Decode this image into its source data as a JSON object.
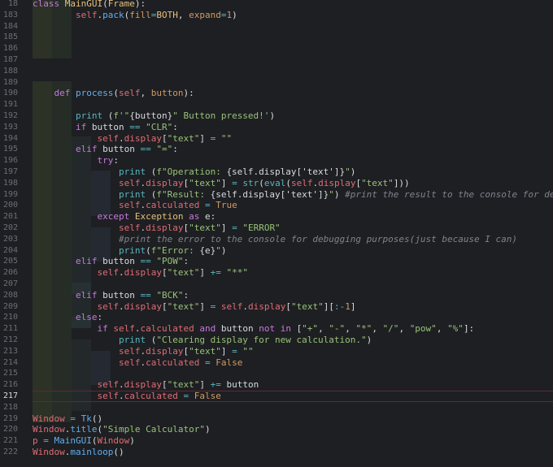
{
  "editor": {
    "current_line": "217",
    "lines": [
      {
        "n": "18",
        "t": [
          [
            "kw",
            "class "
          ],
          [
            "cls",
            "MainGUI"
          ],
          [
            "plain",
            "("
          ],
          [
            "cls",
            "Frame"
          ],
          [
            "plain",
            "):"
          ]
        ]
      },
      {
        "n": "183",
        "t": [
          [
            "plain",
            "        "
          ],
          [
            "self",
            "self"
          ],
          [
            "plain",
            "."
          ],
          [
            "fn",
            "pack"
          ],
          [
            "plain",
            "("
          ],
          [
            "param",
            "fill"
          ],
          [
            "op",
            "="
          ],
          [
            "cls",
            "BOTH"
          ],
          [
            "plain",
            ", "
          ],
          [
            "param",
            "expand"
          ],
          [
            "op",
            "="
          ],
          [
            "num",
            "1"
          ],
          [
            "plain",
            ")"
          ]
        ]
      },
      {
        "n": "184",
        "t": []
      },
      {
        "n": "185",
        "t": []
      },
      {
        "n": "186",
        "t": []
      },
      {
        "n": "187",
        "t": []
      },
      {
        "n": "188",
        "t": []
      },
      {
        "n": "189",
        "t": []
      },
      {
        "n": "190",
        "t": [
          [
            "plain",
            "    "
          ],
          [
            "kw",
            "def "
          ],
          [
            "fn",
            "process"
          ],
          [
            "plain",
            "("
          ],
          [
            "self",
            "self"
          ],
          [
            "plain",
            ", "
          ],
          [
            "param",
            "button"
          ],
          [
            "plain",
            "):"
          ]
        ]
      },
      {
        "n": "191",
        "t": []
      },
      {
        "n": "192",
        "t": [
          [
            "plain",
            "        "
          ],
          [
            "bltin",
            "print"
          ],
          [
            "plain",
            " ("
          ],
          [
            "str",
            "f'\""
          ],
          [
            "plain",
            "{button}"
          ],
          [
            "str",
            "\" Button pressed!'"
          ],
          [
            "plain",
            ")"
          ]
        ]
      },
      {
        "n": "193",
        "t": [
          [
            "plain",
            "        "
          ],
          [
            "kw",
            "if "
          ],
          [
            "plain",
            "button "
          ],
          [
            "op",
            "=="
          ],
          [
            "str",
            " \"CLR\""
          ],
          [
            "plain",
            ":"
          ]
        ]
      },
      {
        "n": "194",
        "t": [
          [
            "plain",
            "            "
          ],
          [
            "self",
            "self"
          ],
          [
            "plain",
            "."
          ],
          [
            "attr",
            "display"
          ],
          [
            "plain",
            "["
          ],
          [
            "str",
            "\"text\""
          ],
          [
            "plain",
            "] "
          ],
          [
            "op",
            "="
          ],
          [
            "str",
            " \"\""
          ]
        ]
      },
      {
        "n": "195",
        "t": [
          [
            "plain",
            "        "
          ],
          [
            "kw",
            "elif "
          ],
          [
            "plain",
            "button "
          ],
          [
            "op",
            "=="
          ],
          [
            "str",
            " \"=\""
          ],
          [
            "plain",
            ":"
          ]
        ]
      },
      {
        "n": "196",
        "t": [
          [
            "plain",
            "            "
          ],
          [
            "kw",
            "try"
          ],
          [
            "plain",
            ":"
          ]
        ]
      },
      {
        "n": "197",
        "t": [
          [
            "plain",
            "                "
          ],
          [
            "bltin",
            "print"
          ],
          [
            "plain",
            " ("
          ],
          [
            "str",
            "f\"Operation: "
          ],
          [
            "plain",
            "{self.display['text']}"
          ],
          [
            "str",
            "\""
          ],
          [
            "plain",
            ")"
          ]
        ]
      },
      {
        "n": "198",
        "t": [
          [
            "plain",
            "                "
          ],
          [
            "self",
            "self"
          ],
          [
            "plain",
            "."
          ],
          [
            "attr",
            "display"
          ],
          [
            "plain",
            "["
          ],
          [
            "str",
            "\"text\""
          ],
          [
            "plain",
            "] "
          ],
          [
            "op",
            "="
          ],
          [
            "plain",
            " "
          ],
          [
            "bltin",
            "str"
          ],
          [
            "plain",
            "("
          ],
          [
            "bltin",
            "eval"
          ],
          [
            "plain",
            "("
          ],
          [
            "self",
            "self"
          ],
          [
            "plain",
            "."
          ],
          [
            "attr",
            "display"
          ],
          [
            "plain",
            "["
          ],
          [
            "str",
            "\"text\""
          ],
          [
            "plain",
            "]))"
          ]
        ]
      },
      {
        "n": "199",
        "t": [
          [
            "plain",
            "                "
          ],
          [
            "bltin",
            "print"
          ],
          [
            "plain",
            " ("
          ],
          [
            "str",
            "f\"Result: "
          ],
          [
            "plain",
            "{self.display['text']}"
          ],
          [
            "str",
            "\""
          ],
          [
            "plain",
            ") "
          ],
          [
            "cmt",
            "#print the result to the console for debugging"
          ]
        ]
      },
      {
        "n": "200",
        "t": [
          [
            "plain",
            "                "
          ],
          [
            "self",
            "self"
          ],
          [
            "plain",
            "."
          ],
          [
            "attr",
            "calculated"
          ],
          [
            "plain",
            " "
          ],
          [
            "op",
            "="
          ],
          [
            "plain",
            " "
          ],
          [
            "num",
            "True"
          ]
        ]
      },
      {
        "n": "201",
        "t": [
          [
            "plain",
            "            "
          ],
          [
            "kw",
            "except "
          ],
          [
            "cls",
            "Exception"
          ],
          [
            "kw",
            " as "
          ],
          [
            "plain",
            "e:"
          ]
        ]
      },
      {
        "n": "202",
        "t": [
          [
            "plain",
            "                "
          ],
          [
            "self",
            "self"
          ],
          [
            "plain",
            "."
          ],
          [
            "attr",
            "display"
          ],
          [
            "plain",
            "["
          ],
          [
            "str",
            "\"text\""
          ],
          [
            "plain",
            "] "
          ],
          [
            "op",
            "="
          ],
          [
            "str",
            " \"ERROR\""
          ]
        ]
      },
      {
        "n": "203",
        "t": [
          [
            "plain",
            "                "
          ],
          [
            "cmt",
            "#print the error to the console for debugging purposes(just because I can)"
          ]
        ]
      },
      {
        "n": "204",
        "t": [
          [
            "plain",
            "                "
          ],
          [
            "bltin",
            "print"
          ],
          [
            "plain",
            "("
          ],
          [
            "str",
            "f\"Error: "
          ],
          [
            "plain",
            "{e}"
          ],
          [
            "str",
            "\""
          ],
          [
            "plain",
            ")"
          ]
        ]
      },
      {
        "n": "205",
        "t": [
          [
            "plain",
            "        "
          ],
          [
            "kw",
            "elif "
          ],
          [
            "plain",
            "button "
          ],
          [
            "op",
            "=="
          ],
          [
            "str",
            " \"POW\""
          ],
          [
            "plain",
            ":"
          ]
        ]
      },
      {
        "n": "206",
        "t": [
          [
            "plain",
            "            "
          ],
          [
            "self",
            "self"
          ],
          [
            "plain",
            "."
          ],
          [
            "attr",
            "display"
          ],
          [
            "plain",
            "["
          ],
          [
            "str",
            "\"text\""
          ],
          [
            "plain",
            "] "
          ],
          [
            "op",
            "+="
          ],
          [
            "str",
            " \"**\""
          ]
        ]
      },
      {
        "n": "207",
        "t": []
      },
      {
        "n": "208",
        "t": [
          [
            "plain",
            "        "
          ],
          [
            "kw",
            "elif "
          ],
          [
            "plain",
            "button "
          ],
          [
            "op",
            "=="
          ],
          [
            "str",
            " \"BCK\""
          ],
          [
            "plain",
            ":"
          ]
        ]
      },
      {
        "n": "209",
        "t": [
          [
            "plain",
            "            "
          ],
          [
            "self",
            "self"
          ],
          [
            "plain",
            "."
          ],
          [
            "attr",
            "display"
          ],
          [
            "plain",
            "["
          ],
          [
            "str",
            "\"text\""
          ],
          [
            "plain",
            "] "
          ],
          [
            "op",
            "="
          ],
          [
            "plain",
            " "
          ],
          [
            "self",
            "self"
          ],
          [
            "plain",
            "."
          ],
          [
            "attr",
            "display"
          ],
          [
            "plain",
            "["
          ],
          [
            "str",
            "\"text\""
          ],
          [
            "plain",
            "]["
          ],
          [
            "op",
            ":-"
          ],
          [
            "num",
            "1"
          ],
          [
            "plain",
            "]"
          ]
        ]
      },
      {
        "n": "210",
        "t": [
          [
            "plain",
            "        "
          ],
          [
            "kw",
            "else"
          ],
          [
            "plain",
            ":"
          ]
        ]
      },
      {
        "n": "211",
        "t": [
          [
            "plain",
            "            "
          ],
          [
            "kw",
            "if "
          ],
          [
            "self",
            "self"
          ],
          [
            "plain",
            "."
          ],
          [
            "attr",
            "calculated"
          ],
          [
            "kw",
            " and "
          ],
          [
            "plain",
            "button "
          ],
          [
            "kw",
            "not in "
          ],
          [
            "plain",
            "["
          ],
          [
            "str",
            "\"+\""
          ],
          [
            "plain",
            ", "
          ],
          [
            "str",
            "\"-\""
          ],
          [
            "plain",
            ", "
          ],
          [
            "str",
            "\"*\""
          ],
          [
            "plain",
            ", "
          ],
          [
            "str",
            "\"/\""
          ],
          [
            "plain",
            ", "
          ],
          [
            "str",
            "\"pow\""
          ],
          [
            "plain",
            ", "
          ],
          [
            "str",
            "\"%\""
          ],
          [
            "plain",
            "]:"
          ]
        ]
      },
      {
        "n": "212",
        "t": [
          [
            "plain",
            "                "
          ],
          [
            "bltin",
            "print"
          ],
          [
            "plain",
            " ("
          ],
          [
            "str",
            "\"Clearing display for new calculation.\""
          ],
          [
            "plain",
            ")"
          ]
        ]
      },
      {
        "n": "213",
        "t": [
          [
            "plain",
            "                "
          ],
          [
            "self",
            "self"
          ],
          [
            "plain",
            "."
          ],
          [
            "attr",
            "display"
          ],
          [
            "plain",
            "["
          ],
          [
            "str",
            "\"text\""
          ],
          [
            "plain",
            "] "
          ],
          [
            "op",
            "="
          ],
          [
            "str",
            " \"\""
          ]
        ]
      },
      {
        "n": "214",
        "t": [
          [
            "plain",
            "                "
          ],
          [
            "self",
            "self"
          ],
          [
            "plain",
            "."
          ],
          [
            "attr",
            "calculated"
          ],
          [
            "plain",
            " "
          ],
          [
            "op",
            "="
          ],
          [
            "plain",
            " "
          ],
          [
            "num",
            "False"
          ]
        ]
      },
      {
        "n": "215",
        "t": []
      },
      {
        "n": "216",
        "t": [
          [
            "plain",
            "            "
          ],
          [
            "self",
            "self"
          ],
          [
            "plain",
            "."
          ],
          [
            "attr",
            "display"
          ],
          [
            "plain",
            "["
          ],
          [
            "str",
            "\"text\""
          ],
          [
            "plain",
            "] "
          ],
          [
            "op",
            "+="
          ],
          [
            "plain",
            " button"
          ]
        ]
      },
      {
        "n": "217",
        "t": [
          [
            "plain",
            "            "
          ],
          [
            "self",
            "self"
          ],
          [
            "plain",
            "."
          ],
          [
            "attr",
            "calculated"
          ],
          [
            "plain",
            " "
          ],
          [
            "op",
            "="
          ],
          [
            "plain",
            " "
          ],
          [
            "num",
            "False"
          ]
        ]
      },
      {
        "n": "218",
        "t": []
      },
      {
        "n": "219",
        "t": [
          [
            "self",
            "Window"
          ],
          [
            "plain",
            " "
          ],
          [
            "op",
            "="
          ],
          [
            "plain",
            " "
          ],
          [
            "fn",
            "Tk"
          ],
          [
            "plain",
            "()"
          ]
        ]
      },
      {
        "n": "220",
        "t": [
          [
            "self",
            "Window"
          ],
          [
            "plain",
            "."
          ],
          [
            "fn",
            "title"
          ],
          [
            "plain",
            "("
          ],
          [
            "str",
            "\"Simple Calculator\""
          ],
          [
            "plain",
            ")"
          ]
        ]
      },
      {
        "n": "221",
        "t": [
          [
            "self",
            "p"
          ],
          [
            "plain",
            " "
          ],
          [
            "op",
            "="
          ],
          [
            "plain",
            " "
          ],
          [
            "fn",
            "MainGUI"
          ],
          [
            "plain",
            "("
          ],
          [
            "self",
            "Window"
          ],
          [
            "plain",
            ")"
          ]
        ]
      },
      {
        "n": "222",
        "t": [
          [
            "self",
            "Window"
          ],
          [
            "plain",
            "."
          ],
          [
            "fn",
            "mainloop"
          ],
          [
            "plain",
            "()"
          ]
        ]
      }
    ]
  }
}
